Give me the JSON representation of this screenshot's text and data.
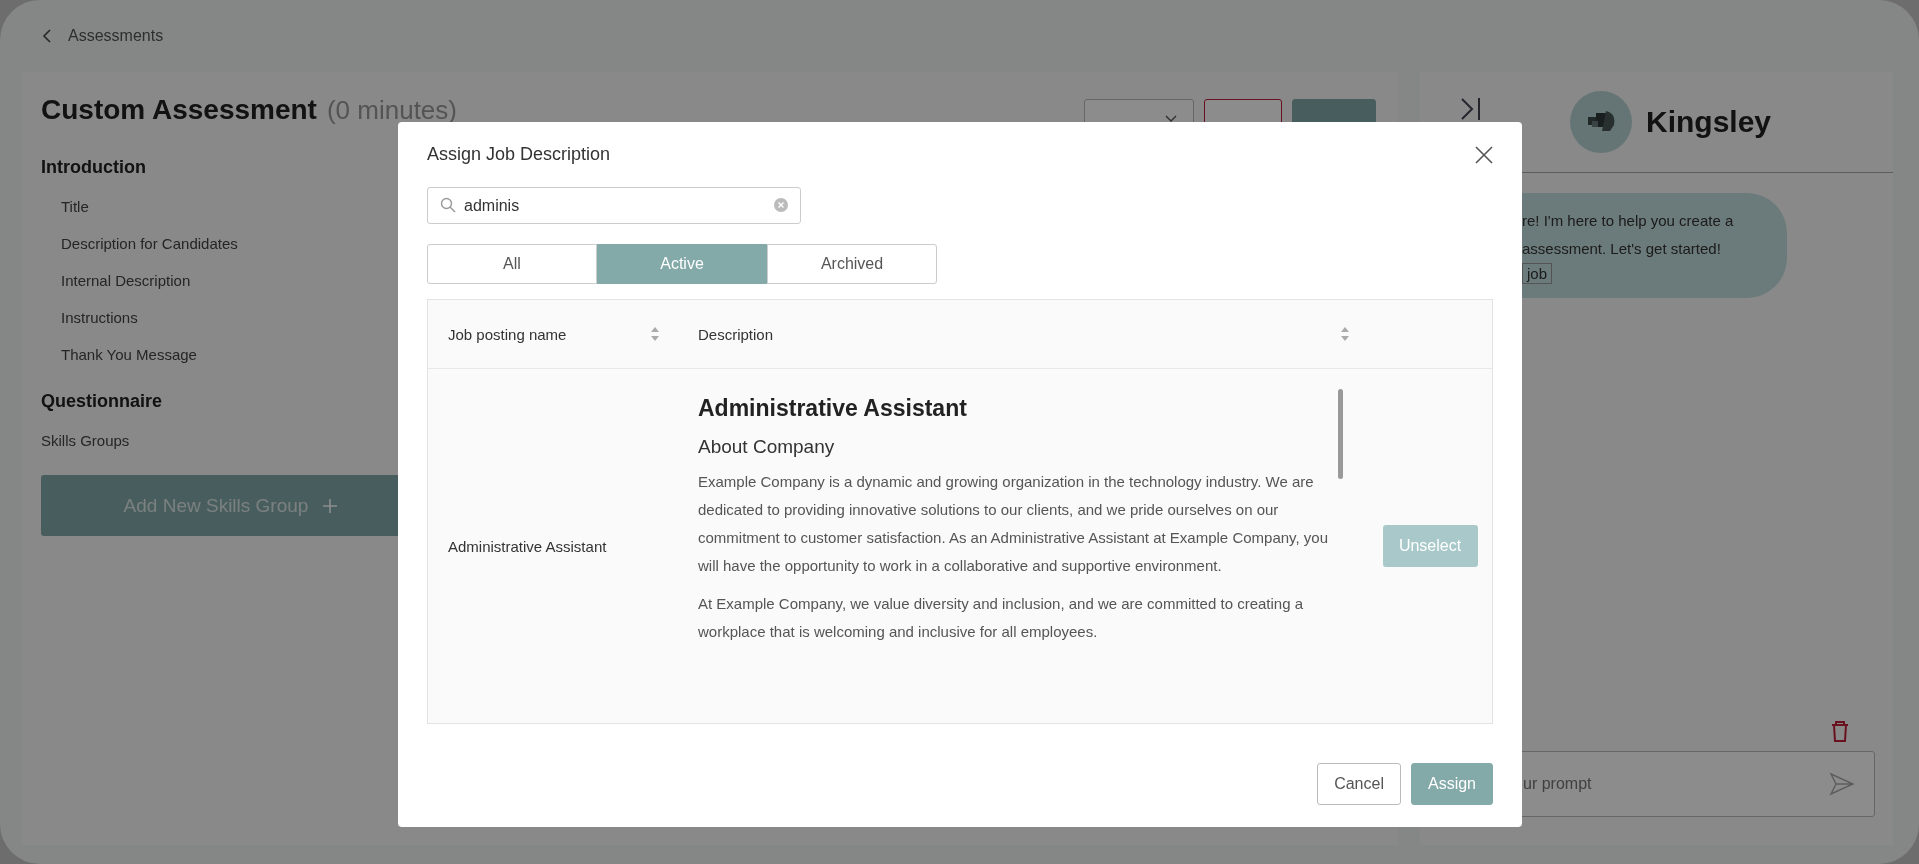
{
  "breadcrumb": {
    "label": "Assessments"
  },
  "assessment": {
    "title": "Custom Assessment",
    "duration": "(0 minutes)",
    "actions": [
      {
        "kind": "dropdown"
      },
      {
        "kind": "danger"
      },
      {
        "kind": "primary"
      }
    ]
  },
  "outline": [
    {
      "heading": "Introduction",
      "indented": true,
      "items": [
        "Title",
        "Description for Candidates",
        "Internal Description",
        "Instructions",
        "Thank You Message"
      ]
    },
    {
      "heading": "Questionnaire",
      "indented": false,
      "items": [
        "Skills Groups"
      ]
    }
  ],
  "add_button": {
    "label": "Add New Skills Group"
  },
  "assistant": {
    "name": "Kingsley",
    "messages": [
      {
        "lines": [
          "re! I'm here to help you create a",
          "assessment. Let's get started!"
        ],
        "chip": "job"
      }
    ],
    "prompt": {
      "placeholder": "ur prompt"
    }
  },
  "modal": {
    "title": "Assign Job Description",
    "search": {
      "value": "adminis"
    },
    "tabs": [
      {
        "label": "All",
        "selected": false
      },
      {
        "label": "Active",
        "selected": true
      },
      {
        "label": "Archived",
        "selected": false
      }
    ],
    "table": {
      "columns": [
        "Job posting name",
        "Description"
      ],
      "rows": [
        {
          "name": "Administrative Assistant",
          "heading": "Administrative Assistant",
          "subheading": "About Company",
          "paragraphs": [
            "Example Company is a dynamic and growing organization in the technology industry. We are dedicated to providing innovative solutions to our clients, and we pride ourselves on our commitment to customer satisfaction. As an Administrative Assistant at Example Company, you will have the opportunity to work in a collaborative and supportive environment.",
            "At Example Company, we value diversity and inclusion, and we are committed to creating a workplace that is welcoming and inclusive for all employees."
          ],
          "action": "Unselect"
        }
      ]
    },
    "buttons": [
      {
        "label": "Cancel",
        "kind": "secondary"
      },
      {
        "label": "Assign",
        "kind": "primary"
      }
    ]
  }
}
